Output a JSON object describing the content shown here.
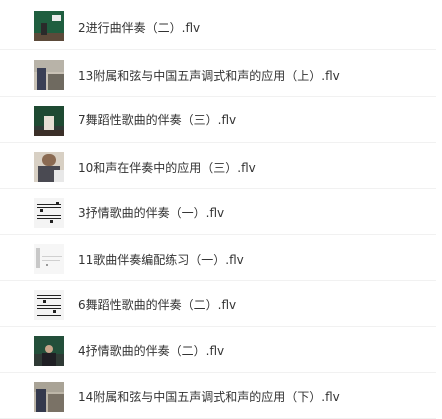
{
  "files": [
    {
      "name": "2进行曲伴奏（二）.flv",
      "thumb": "video-thumbnail"
    },
    {
      "name": "13附属和弦与中国五声调式和声的应用（上）.flv",
      "thumb": "video-thumbnail"
    },
    {
      "name": "7舞蹈性歌曲的伴奏（三）.flv",
      "thumb": "video-thumbnail"
    },
    {
      "name": "10和声在伴奏中的应用（三）.flv",
      "thumb": "video-thumbnail"
    },
    {
      "name": "3抒情歌曲的伴奏（一）.flv",
      "thumb": "sheet-music-thumbnail"
    },
    {
      "name": "11歌曲伴奏编配练习（一）.flv",
      "thumb": "sheet-music-thumbnail"
    },
    {
      "name": "6舞蹈性歌曲的伴奏（二）.flv",
      "thumb": "sheet-music-thumbnail"
    },
    {
      "name": "4抒情歌曲的伴奏（二）.flv",
      "thumb": "video-thumbnail"
    },
    {
      "name": "14附属和弦与中国五声调式和声的应用（下）.flv",
      "thumb": "video-thumbnail"
    }
  ],
  "colors": {
    "text": "#333333",
    "divider": "#f1f1f1",
    "background": "#ffffff"
  }
}
